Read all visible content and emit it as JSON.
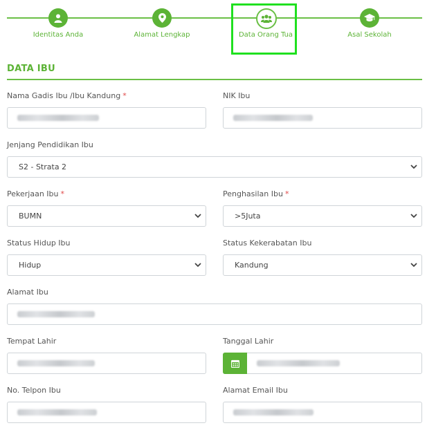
{
  "stepper": {
    "steps": [
      {
        "label": "Identitas Anda",
        "icon": "user-icon"
      },
      {
        "label": "Alamat Lengkap",
        "icon": "map-marker-icon"
      },
      {
        "label": "Data Orang Tua",
        "icon": "users-icon"
      },
      {
        "label": "Asal Sekolah",
        "icon": "graduation-cap-icon"
      }
    ],
    "active_index": 2
  },
  "section": {
    "title": "DATA IBU"
  },
  "form": {
    "nama_gadis_label": "Nama Gadis Ibu /Ibu Kandung",
    "required_mark": "*",
    "nik_label": "NIK Ibu",
    "jenjang_label": "Jenjang Pendidikan Ibu",
    "jenjang_value": "S2 - Strata 2",
    "pekerjaan_label": "Pekerjaan Ibu",
    "pekerjaan_value": "BUMN",
    "penghasilan_label": "Penghasilan Ibu",
    "penghasilan_value": ">5Juta",
    "status_hidup_label": "Status Hidup Ibu",
    "status_hidup_value": "Hidup",
    "status_kekerabatan_label": "Status Kekerabatan Ibu",
    "status_kekerabatan_value": "Kandung",
    "alamat_label": "Alamat Ibu",
    "tempat_lahir_label": "Tempat Lahir",
    "tanggal_lahir_label": "Tanggal Lahir",
    "telpon_label": "No. Telpon Ibu",
    "email_label": "Alamat Email Ibu"
  },
  "colors": {
    "accent": "#5cb336",
    "active_highlight": "#1fe01f",
    "required": "#e04848"
  }
}
